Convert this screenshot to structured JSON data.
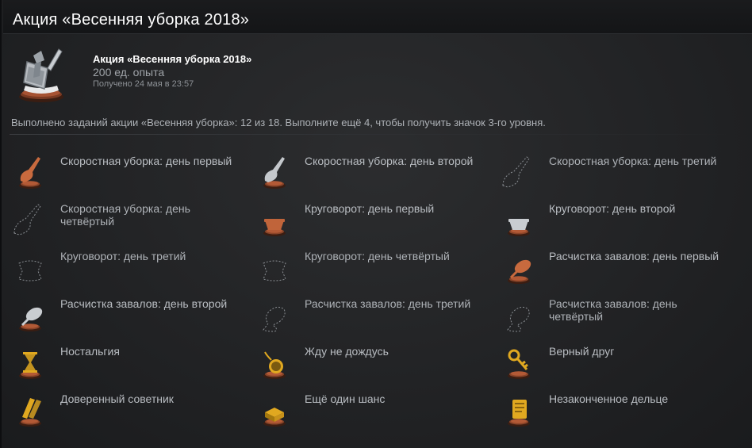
{
  "header": {
    "title": "Акция «Весенняя уборка 2018»"
  },
  "badge": {
    "name": "Акция «Весенняя уборка 2018»",
    "xp": "200 ед. опыта",
    "unlocked": "Получено 24 мая в 23:57",
    "icon": "dustpan-brush-icon"
  },
  "progress": {
    "text": "Выполнено заданий акции «Весенняя уборка»: 12 из 18. Выполните ещё 4, чтобы получить значок 3-го уровня.",
    "done": 12,
    "total": 18
  },
  "tasks": [
    {
      "label": "Скоростная уборка: день первый",
      "icon": "broom-icon",
      "done": true,
      "color": "#c86a3e"
    },
    {
      "label": "Скоростная уборка: день второй",
      "icon": "broom-icon",
      "done": true,
      "color": "#c4c8cc"
    },
    {
      "label": "Скоростная уборка: день третий",
      "icon": "broom-icon",
      "done": false
    },
    {
      "label": "Скоростная уборка: день четвёртый",
      "icon": "broom-icon",
      "done": false
    },
    {
      "label": "Круговорот: день первый",
      "icon": "basket-icon",
      "done": true,
      "color": "#c0643a"
    },
    {
      "label": "Круговорот: день второй",
      "icon": "basket-icon",
      "done": true,
      "color": "#c9cdd1"
    },
    {
      "label": "Круговорот: день третий",
      "icon": "basket-icon",
      "done": false
    },
    {
      "label": "Круговорот: день четвёртый",
      "icon": "basket-icon",
      "done": false
    },
    {
      "label": "Расчистка завалов: день первый",
      "icon": "duster-icon",
      "done": true,
      "color": "#c86a3e"
    },
    {
      "label": "Расчистка завалов: день второй",
      "icon": "duster-icon",
      "done": true,
      "color": "#c9cdd1"
    },
    {
      "label": "Расчистка завалов: день третий",
      "icon": "duster-icon",
      "done": false
    },
    {
      "label": "Расчистка завалов: день четвёртый",
      "icon": "duster-icon",
      "done": false
    },
    {
      "label": "Ностальгия",
      "icon": "hourglass-icon",
      "done": true,
      "color": "#e0a820"
    },
    {
      "label": "Жду не дождусь",
      "icon": "pocket-watch-icon",
      "done": true,
      "color": "#e0a820"
    },
    {
      "label": "Верный друг",
      "icon": "key-icon",
      "done": true,
      "color": "#e0a820"
    },
    {
      "label": "Доверенный советник",
      "icon": "scrolls-icon",
      "done": true,
      "color": "#e0a820"
    },
    {
      "label": "Ещё один шанс",
      "icon": "dice-icon",
      "done": true,
      "color": "#e0a820"
    },
    {
      "label": "Незаконченное дельце",
      "icon": "document-icon",
      "done": true,
      "color": "#e0a820"
    }
  ]
}
